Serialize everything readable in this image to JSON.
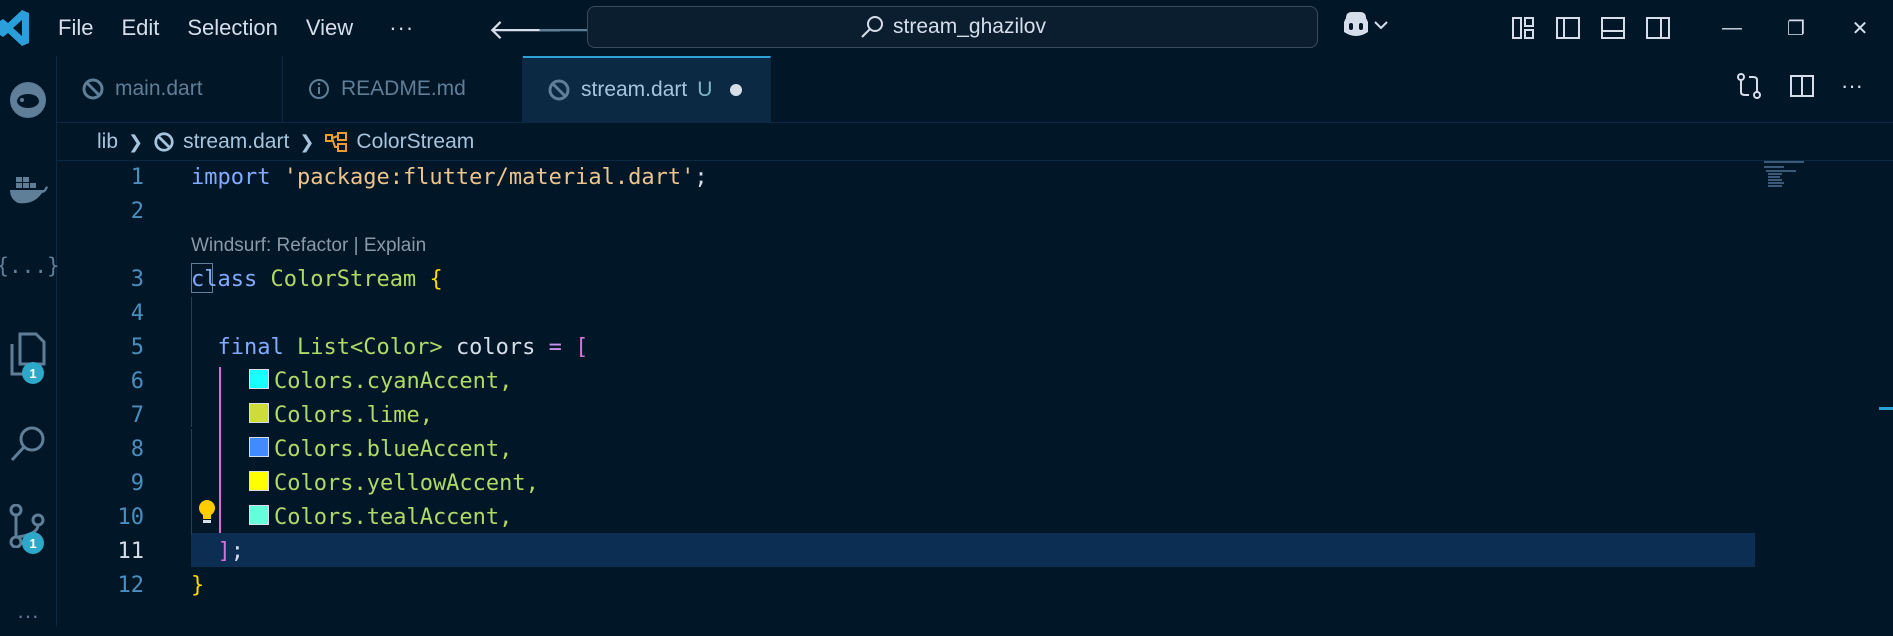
{
  "menu": {
    "items": [
      "File",
      "Edit",
      "Selection",
      "View"
    ],
    "more": "···"
  },
  "search": {
    "text": "stream_ghazilov"
  },
  "window_controls": {
    "minimize": "—",
    "restore": "❐",
    "close": "✕"
  },
  "activity_bar": {
    "extensions_label": "{...}",
    "explorer_badge": "1",
    "source_control_badge": "1",
    "more": "···"
  },
  "tabs": [
    {
      "label": "main.dart",
      "icon": "dart-icon"
    },
    {
      "label": "README.md",
      "icon": "info-icon"
    },
    {
      "label": "stream.dart",
      "icon": "dart-icon",
      "status": "U",
      "modified": true,
      "active": true
    }
  ],
  "breadcrumb": {
    "folder": "lib",
    "file": "stream.dart",
    "symbol": "ColorStream"
  },
  "editor": {
    "codelens": "Windsurf: Refactor | Explain",
    "line_numbers": [
      "1",
      "2",
      "3",
      "4",
      "5",
      "6",
      "7",
      "8",
      "9",
      "10",
      "11",
      "12"
    ],
    "current_line": "11",
    "code": {
      "l1_kw": "import",
      "l1_str": "'package:flutter/material.dart'",
      "l1_end": ";",
      "l3_kw": "class",
      "l3_cls": "ColorStream",
      "l3_brace": "{",
      "l5_kw": "final",
      "l5_type": "List<Color>",
      "l5_name": "colors",
      "l5_op": "=",
      "l5_bracket": "[",
      "l6": "Colors.cyanAccent,",
      "l7": "Colors.lime,",
      "l8": "Colors.blueAccent,",
      "l9": "Colors.yellowAccent,",
      "l10": "Colors.tealAccent,",
      "l11_bracket": "]",
      "l11_end": ";",
      "l12_brace": "}"
    },
    "swatches": {
      "cyanAccent": "#18FFFF",
      "lime": "#CDDC39",
      "blueAccent": "#448AFF",
      "yellowAccent": "#FFFF00",
      "tealAccent": "#64FFDA"
    }
  }
}
